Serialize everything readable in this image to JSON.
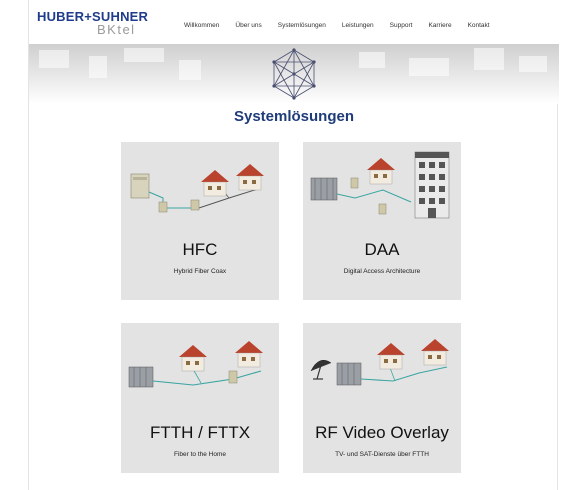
{
  "brand": {
    "name": "HUBER+SUHNER",
    "sub": "BKtel"
  },
  "nav": {
    "items": [
      "Willkommen",
      "Über uns",
      "Systemlösungen",
      "Leistungen",
      "Support",
      "Karriere",
      "Kontakt"
    ]
  },
  "page": {
    "title": "Systemlösungen"
  },
  "tiles": [
    {
      "title": "HFC",
      "subtitle": "Hybrid Fiber Coax"
    },
    {
      "title": "DAA",
      "subtitle": "Digital Access Architecture"
    },
    {
      "title": "FTTH / FTTX",
      "subtitle": "Fiber to the Home"
    },
    {
      "title": "RF Video Overlay",
      "subtitle": "TV- und SAT-Dienste über FTTH"
    }
  ],
  "colors": {
    "brand_blue": "#1f3c8c",
    "title_blue": "#1f3c7a",
    "tile_bg": "#e3e3e3",
    "fiber": "#39a5a0"
  }
}
